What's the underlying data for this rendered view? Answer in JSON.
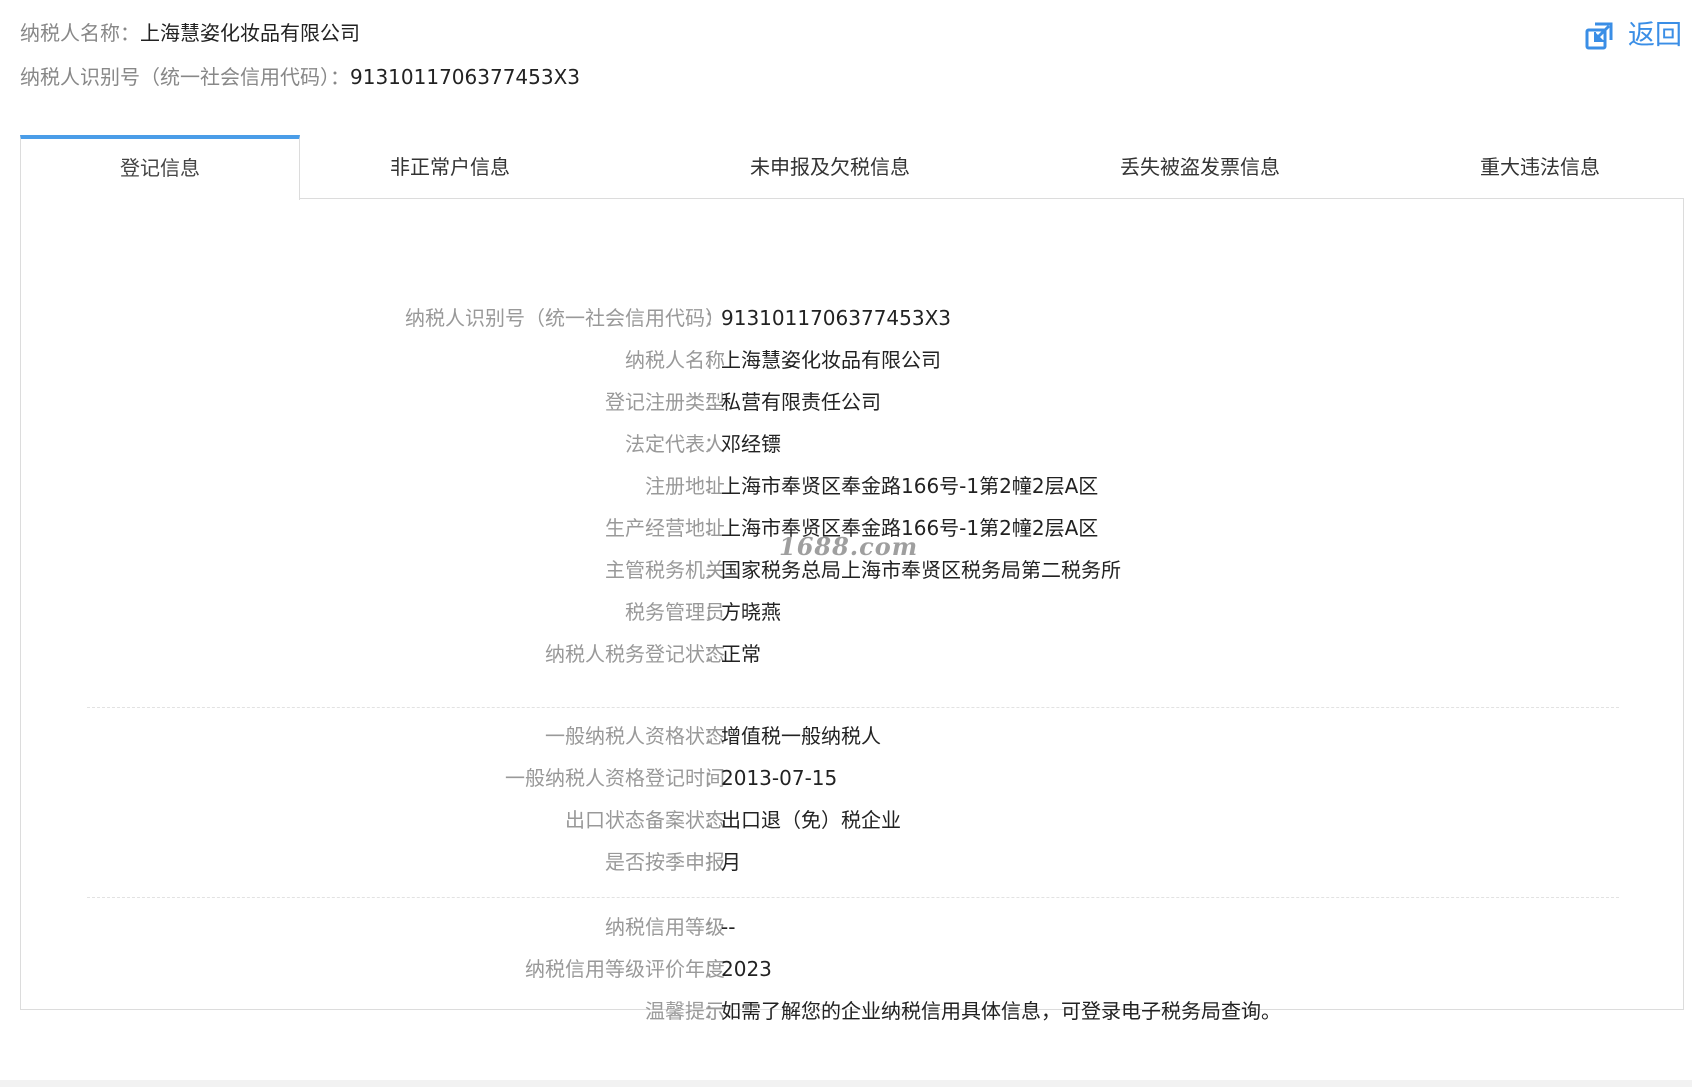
{
  "header": {
    "name_label": "纳税人名称：",
    "name_value": "上海慧姿化妆品有限公司",
    "id_label": "纳税人识别号（统一社会信用代码）：",
    "id_value": "9131011706377453X3",
    "back_label": "返回",
    "back_icon": "return-arrow-icon"
  },
  "tabs": [
    {
      "label": "登记信息",
      "active": true
    },
    {
      "label": "非正常户信息",
      "active": false
    },
    {
      "label": "未申报及欠税信息",
      "active": false
    },
    {
      "label": "丢失被盗发票信息",
      "active": false
    },
    {
      "label": "重大违法信息",
      "active": false
    }
  ],
  "colon": "：",
  "sections": [
    [
      {
        "label": "纳税人识别号（统一社会信用代码）",
        "value": "9131011706377453X3"
      },
      {
        "label": "纳税人名称",
        "value": "上海慧姿化妆品有限公司"
      },
      {
        "label": "登记注册类型",
        "value": "私营有限责任公司"
      },
      {
        "label": "法定代表人",
        "value": "邓经镖"
      },
      {
        "label": "注册地址",
        "value": "上海市奉贤区奉金路166号-1第2幢2层A区"
      },
      {
        "label": "生产经营地址",
        "value": "上海市奉贤区奉金路166号-1第2幢2层A区"
      },
      {
        "label": "主管税务机关",
        "value": "国家税务总局上海市奉贤区税务局第二税务所"
      },
      {
        "label": "税务管理员",
        "value": "方晓燕"
      },
      {
        "label": "纳税人税务登记状态",
        "value": "正常"
      }
    ],
    [
      {
        "label": "一般纳税人资格状态",
        "value": "增值税一般纳税人"
      },
      {
        "label": "一般纳税人资格登记时间",
        "value": "2013-07-15"
      },
      {
        "label": "出口状态备案状态",
        "value": "出口退（免）税企业"
      },
      {
        "label": "是否按季申报",
        "value": "月"
      }
    ],
    [
      {
        "label": "纳税信用等级",
        "value": "--"
      },
      {
        "label": "纳税信用等级评价年度",
        "value": "2023"
      },
      {
        "label": "温馨提示",
        "value": "如需了解您的企业纳税信用具体信息，可登录电子税务局查询。"
      }
    ]
  ],
  "watermark": "1688.com",
  "colors": {
    "accent": "#4a9de8",
    "link": "#3a8ee6",
    "label": "#999999",
    "value": "#222222",
    "border": "#dcdcdc"
  }
}
